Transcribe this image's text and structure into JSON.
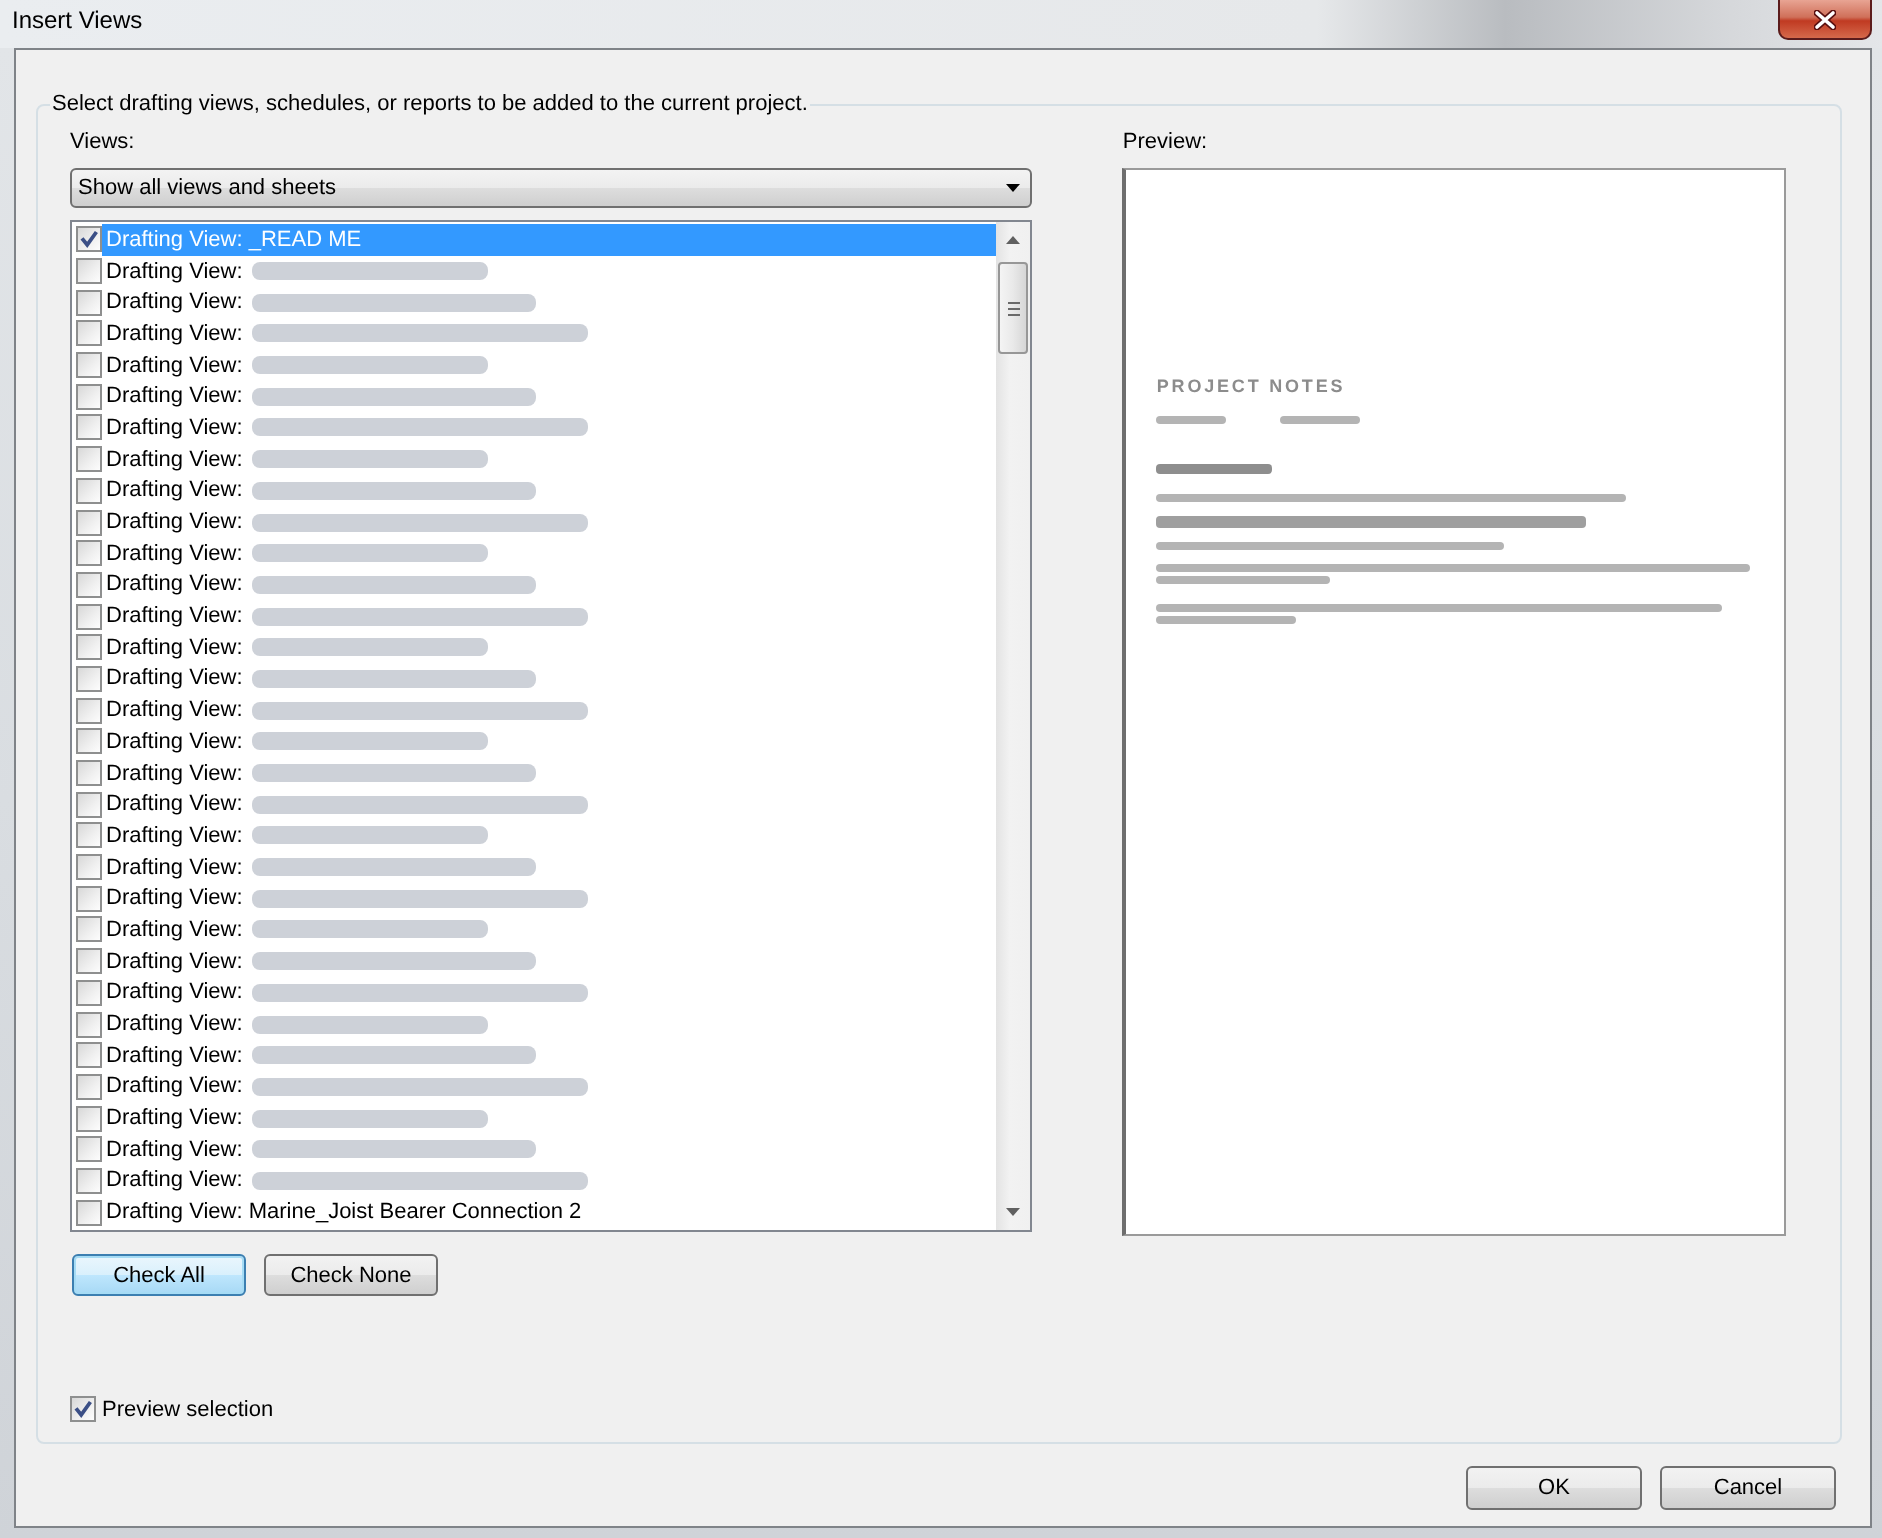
{
  "window": {
    "title": "Insert Views"
  },
  "group": {
    "caption": "Select drafting views, schedules, or reports to be added to the current project."
  },
  "views": {
    "label": "Views:",
    "filter": {
      "value": "Show all views and sheets"
    },
    "items": [
      {
        "text": "Drafting View: _READ ME",
        "blurred": false,
        "checked": true,
        "selected": true
      },
      {
        "text": "Drafting View:",
        "blurred": true,
        "checked": false,
        "selected": false
      },
      {
        "text": "Drafting View:",
        "blurred": true,
        "checked": false,
        "selected": false
      },
      {
        "text": "Drafting View:",
        "blurred": true,
        "checked": false,
        "selected": false
      },
      {
        "text": "Drafting View:",
        "blurred": true,
        "checked": false,
        "selected": false
      },
      {
        "text": "Drafting View:",
        "blurred": true,
        "checked": false,
        "selected": false
      },
      {
        "text": "Drafting View:",
        "blurred": true,
        "checked": false,
        "selected": false
      },
      {
        "text": "Drafting View:",
        "blurred": true,
        "checked": false,
        "selected": false
      },
      {
        "text": "Drafting View:",
        "blurred": true,
        "checked": false,
        "selected": false
      },
      {
        "text": "Drafting View:",
        "blurred": true,
        "checked": false,
        "selected": false
      },
      {
        "text": "Drafting View:",
        "blurred": true,
        "checked": false,
        "selected": false
      },
      {
        "text": "Drafting View:",
        "blurred": true,
        "checked": false,
        "selected": false
      },
      {
        "text": "Drafting View:",
        "blurred": true,
        "checked": false,
        "selected": false
      },
      {
        "text": "Drafting View:",
        "blurred": true,
        "checked": false,
        "selected": false
      },
      {
        "text": "Drafting View:",
        "blurred": true,
        "checked": false,
        "selected": false
      },
      {
        "text": "Drafting View:",
        "blurred": true,
        "checked": false,
        "selected": false
      },
      {
        "text": "Drafting View:",
        "blurred": true,
        "checked": false,
        "selected": false
      },
      {
        "text": "Drafting View:",
        "blurred": true,
        "checked": false,
        "selected": false
      },
      {
        "text": "Drafting View:",
        "blurred": true,
        "checked": false,
        "selected": false
      },
      {
        "text": "Drafting View:",
        "blurred": true,
        "checked": false,
        "selected": false
      },
      {
        "text": "Drafting View:",
        "blurred": true,
        "checked": false,
        "selected": false
      },
      {
        "text": "Drafting View:",
        "blurred": true,
        "checked": false,
        "selected": false
      },
      {
        "text": "Drafting View:",
        "blurred": true,
        "checked": false,
        "selected": false
      },
      {
        "text": "Drafting View:",
        "blurred": true,
        "checked": false,
        "selected": false
      },
      {
        "text": "Drafting View:",
        "blurred": true,
        "checked": false,
        "selected": false
      },
      {
        "text": "Drafting View:",
        "blurred": true,
        "checked": false,
        "selected": false
      },
      {
        "text": "Drafting View:",
        "blurred": true,
        "checked": false,
        "selected": false
      },
      {
        "text": "Drafting View:",
        "blurred": true,
        "checked": false,
        "selected": false
      },
      {
        "text": "Drafting View:",
        "blurred": true,
        "checked": false,
        "selected": false
      },
      {
        "text": "Drafting View:",
        "blurred": true,
        "checked": false,
        "selected": false
      },
      {
        "text": "Drafting View:",
        "blurred": true,
        "checked": false,
        "selected": false
      },
      {
        "text": "Drafting View: Marine_Joist Bearer Connection 2",
        "blurred": false,
        "checked": false,
        "selected": false
      }
    ]
  },
  "list_buttons": [
    {
      "label": "Check All",
      "focused": true
    },
    {
      "label": "Check None",
      "focused": false
    }
  ],
  "preview": {
    "label": "Preview:",
    "document": {
      "title": "PROJECT NOTES"
    }
  },
  "preview_selection": {
    "label": "Preview selection",
    "checked": true
  },
  "buttons": [
    {
      "label": "OK"
    },
    {
      "label": "Cancel"
    }
  ]
}
